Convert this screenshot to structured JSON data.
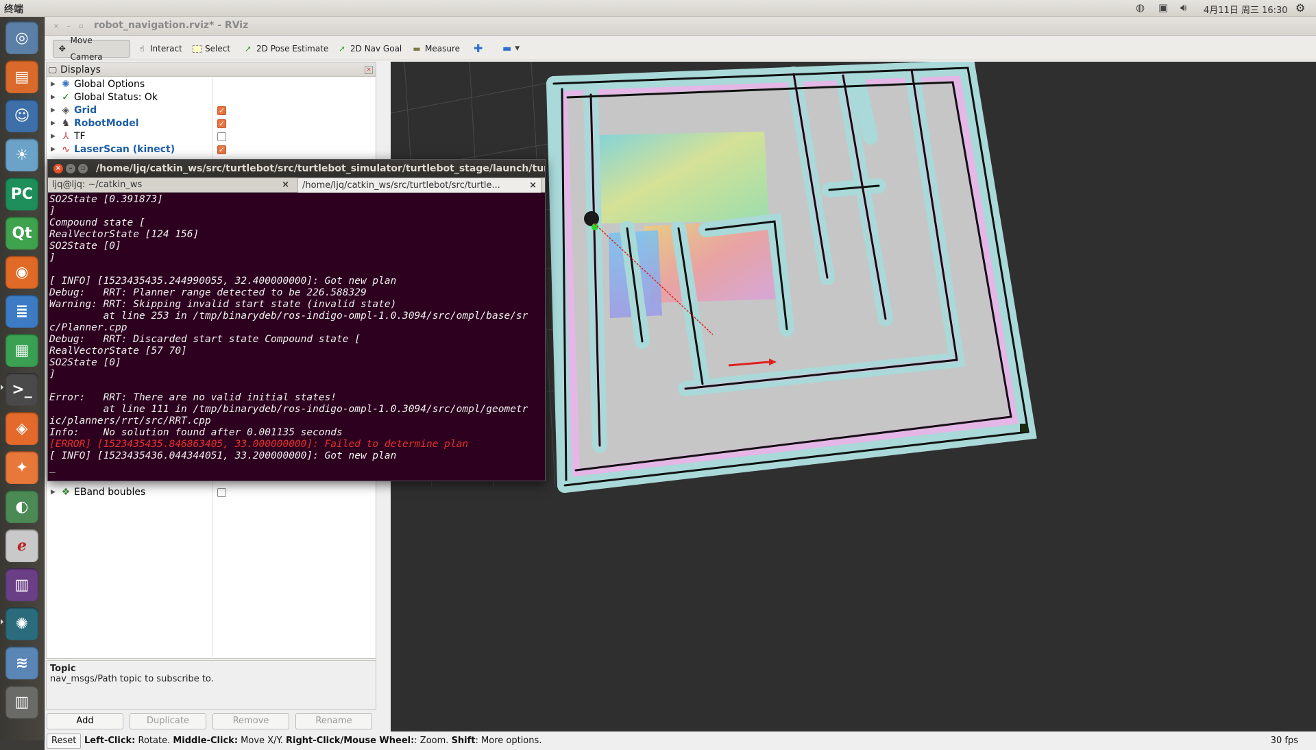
{
  "topbar": {
    "app_name": "终端",
    "clock": "4月11日 周三 16:30"
  },
  "window": {
    "title": "robot_navigation.rviz* - RViz"
  },
  "toolbar": {
    "move_camera": "Move Camera",
    "interact": "Interact",
    "select": "Select",
    "pose_estimate": "2D Pose Estimate",
    "nav_goal": "2D Nav Goal",
    "measure": "Measure"
  },
  "displays": {
    "title": "Displays",
    "items": [
      {
        "label": "Global Options",
        "checked": null
      },
      {
        "label": "Global Status: Ok",
        "checked": null
      },
      {
        "label": "Grid",
        "checked": true
      },
      {
        "label": "RobotModel",
        "checked": true
      },
      {
        "label": "TF",
        "checked": false
      },
      {
        "label": "LaserScan (kinect)",
        "checked": true
      },
      {
        "label": "EBand boubles",
        "checked": false
      }
    ]
  },
  "topic": {
    "title": "Topic",
    "desc": "nav_msgs/Path topic to subscribe to."
  },
  "buttons": {
    "add": "Add",
    "duplicate": "Duplicate",
    "remove": "Remove",
    "rename": "Rename"
  },
  "status": {
    "reset": "Reset",
    "left_click": "Left-Click:",
    "left_click_desc": " Rotate. ",
    "middle_click": "Middle-Click:",
    "middle_click_desc": " Move X/Y. ",
    "right_click": "Right-Click/Mouse Wheel:",
    "right_click_desc": ": Zoom. ",
    "shift": "Shift",
    "shift_desc": ": More options.",
    "fps": "30 fps"
  },
  "terminal": {
    "title": "/home/ljq/catkin_ws/src/turtlebot/src/turtlebot_simulator/turtlebot_stage/launch/turtle",
    "tab1": "ljq@ljq: ~/catkin_ws",
    "tab2": "/home/ljq/catkin_ws/src/turtlebot/src/turtle...",
    "lines": [
      "SO2State [0.391873]",
      "]",
      "Compound state [",
      "RealVectorState [124 156]",
      "SO2State [0]",
      "]",
      "",
      "[ INFO] [1523435435.244990055, 32.400000000]: Got new plan",
      "Debug:   RRT: Planner range detected to be 226.588329",
      "Warning: RRT: Skipping invalid start state (invalid state)",
      "         at line 253 in /tmp/binarydeb/ros-indigo-ompl-1.0.3094/src/ompl/base/sr",
      "c/Planner.cpp",
      "Debug:   RRT: Discarded start state Compound state [",
      "RealVectorState [57 70]",
      "SO2State [0]",
      "]",
      "",
      "Error:   RRT: There are no valid initial states!",
      "         at line 111 in /tmp/binarydeb/ros-indigo-ompl-1.0.3094/src/ompl/geometr",
      "ic/planners/rrt/src/RRT.cpp",
      "Info:    No solution found after 0.001135 seconds"
    ],
    "error_line": "[ERROR] [1523435435.846863405, 33.000000000]: Failed to determine plan",
    "last_line": "[ INFO] [1523435436.044344051, 33.200000000]: Got new plan"
  }
}
